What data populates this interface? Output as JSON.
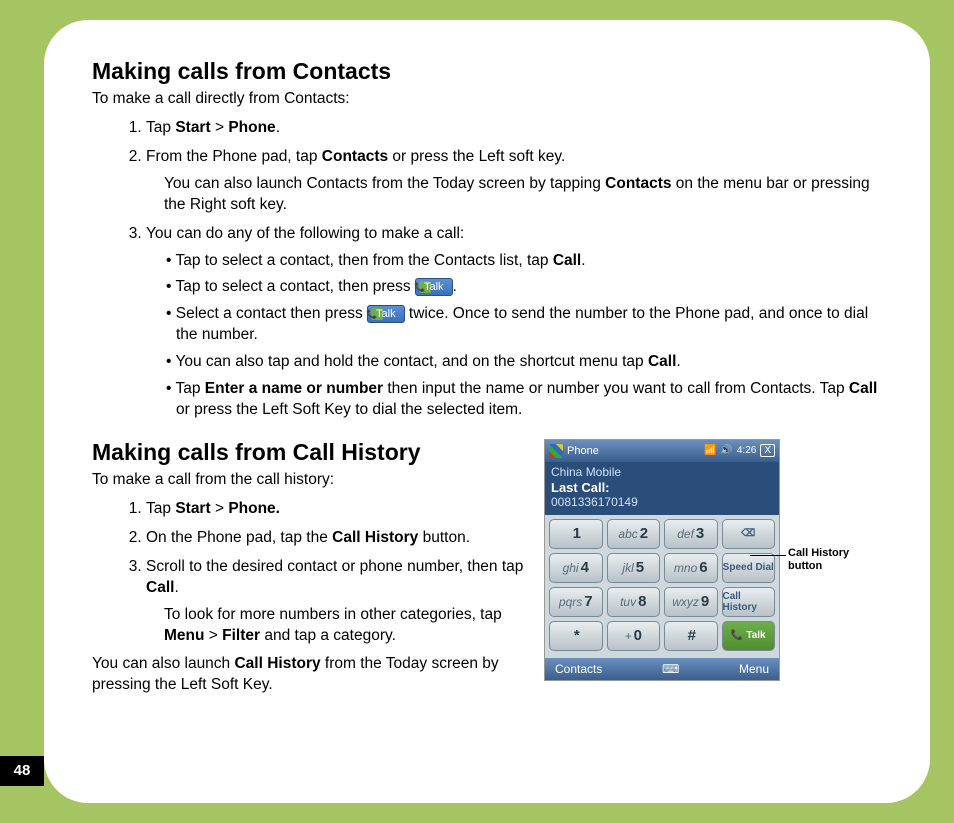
{
  "page_number": "48",
  "section1": {
    "heading": "Making calls from Contacts",
    "intro": "To make a call directly from Contacts:",
    "step1_pre": "Tap ",
    "step1_b1": "Start",
    "step1_mid": " > ",
    "step1_b2": "Phone",
    "step1_post": ".",
    "step2_pre": "From the Phone pad, tap ",
    "step2_b1": "Contacts",
    "step2_post": " or press the Left soft key.",
    "step2_note_pre": "You can also launch Contacts from the Today screen by tapping ",
    "step2_note_b": "Contacts",
    "step2_note_post": " on the menu bar or pressing the Right soft key.",
    "step3": "You can do any of the following to make a call:",
    "b1_pre": "Tap to select a contact, then from the Contacts list, tap ",
    "b1_b": "Call",
    "b1_post": ".",
    "b2_pre": "Tap to select a contact, then press ",
    "b2_post": ".",
    "b3_pre": "Select a contact then press ",
    "b3_post": " twice. Once to send the number to the Phone pad, and once to dial the number.",
    "b4_pre": "You can also tap and hold the contact, and on the shortcut menu tap ",
    "b4_b": "Call",
    "b4_post": ".",
    "b5_pre": "Tap ",
    "b5_b1": "Enter a name or number",
    "b5_mid1": " then input the name or number you want to call from Contacts. Tap ",
    "b5_b2": "Call",
    "b5_post": " or press the Left Soft Key to dial the selected item."
  },
  "section2": {
    "heading": "Making calls from Call History",
    "intro": "To make a call from the call history:",
    "step1_pre": "Tap ",
    "step1_b1": "Start",
    "step1_mid": " > ",
    "step1_b2": "Phone.",
    "step2_pre": "On the Phone pad, tap the ",
    "step2_b": "Call History",
    "step2_post": " button.",
    "step3_pre": "Scroll to the desired contact or phone number, then tap ",
    "step3_b": "Call",
    "step3_post": ".",
    "step3_note_pre": "To look for more numbers in other categories, tap ",
    "step3_note_b1": "Menu",
    "step3_note_mid": " > ",
    "step3_note_b2": "Filter",
    "step3_note_post": " and tap a category.",
    "outro_pre": "You can also launch ",
    "outro_b": "Call History",
    "outro_post": " from the Today screen by pressing the Left Soft Key."
  },
  "talk_label": "Talk",
  "phone": {
    "title": "Phone",
    "time": "4:26",
    "close": "X",
    "carrier": "China Mobile",
    "last_call_label": "Last Call:",
    "last_call_num": "0081336170149",
    "keys": {
      "k1": "1",
      "k2": "2",
      "k2t": "abc",
      "k3": "3",
      "k3t": "def",
      "k4": "4",
      "k4t": "ghi",
      "k5": "5",
      "k5t": "jkl",
      "k6": "6",
      "k6t": "mno",
      "k7": "7",
      "k7t": "pqrs",
      "k8": "8",
      "k8t": "tuv",
      "k9": "9",
      "k9t": "wxyz",
      "kstar": "*",
      "k0": "0",
      "k0t": "+",
      "khash": "#"
    },
    "side": {
      "speed": "Speed Dial",
      "history": "Call History",
      "talk": "Talk"
    },
    "soft_left": "Contacts",
    "soft_right": "Menu"
  },
  "callout": "Call History button"
}
